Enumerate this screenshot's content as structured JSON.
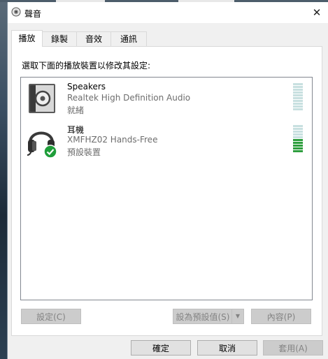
{
  "window": {
    "title": "聲音",
    "close_glyph": "✕"
  },
  "tabs": [
    {
      "label": "播放",
      "active": true
    },
    {
      "label": "錄製",
      "active": false
    },
    {
      "label": "音效",
      "active": false
    },
    {
      "label": "通訊",
      "active": false
    }
  ],
  "instruction": "選取下面的播放裝置以修改其設定:",
  "devices": [
    {
      "name": "Speakers",
      "description": "Realtek High Definition Audio",
      "status": "就緒",
      "icon": "speaker-icon",
      "level": 0
    },
    {
      "name": "耳機",
      "description": "XMFHZ02 Hands-Free",
      "status": "預設裝置",
      "icon": "headphones-icon",
      "default": true,
      "level": 0.5
    }
  ],
  "panel_buttons": {
    "configure": "設定(C)",
    "set_default": "設為預設值(S)",
    "properties": "內容(P)"
  },
  "dialog_buttons": {
    "ok": "確定",
    "cancel": "取消",
    "apply": "套用(A)"
  },
  "colors": {
    "meter_active": "#2e9e3e",
    "meter_idle": "#c8e0e0",
    "check_badge": "#1f9e3a"
  }
}
